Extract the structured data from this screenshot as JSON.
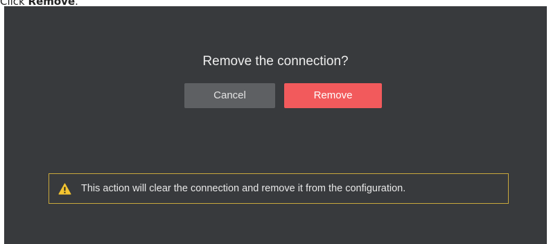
{
  "instruction": {
    "prefix": "Click ",
    "target": "Remove",
    "suffix": "."
  },
  "dialog": {
    "title": "Remove the connection?",
    "cancel_label": "Cancel",
    "remove_label": "Remove",
    "notice_text": "This action will clear the connection and remove it from the configuration.",
    "notice_icon": "warning-triangle-icon"
  },
  "colors": {
    "remove_button": "#f25a5c",
    "warning_icon": "#f4c430"
  }
}
